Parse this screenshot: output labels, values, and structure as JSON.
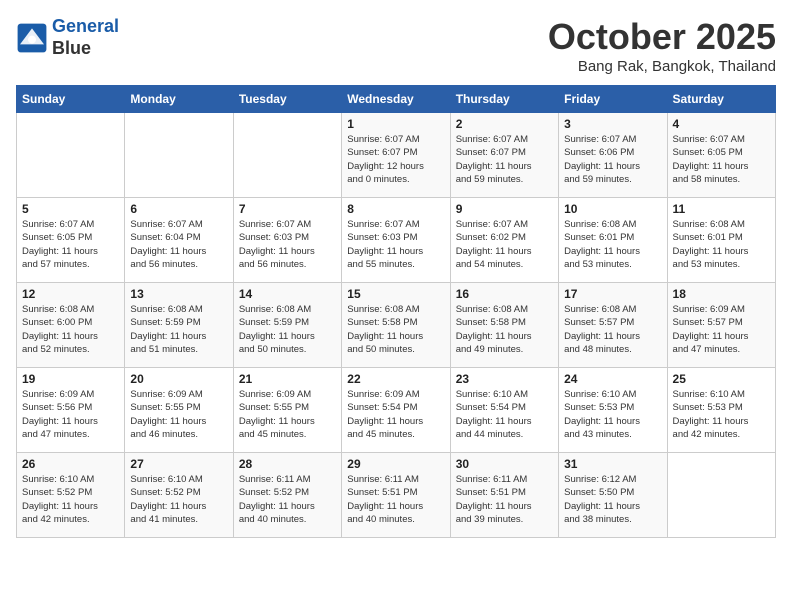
{
  "logo": {
    "line1": "General",
    "line2": "Blue"
  },
  "title": "October 2025",
  "location": "Bang Rak, Bangkok, Thailand",
  "days_of_week": [
    "Sunday",
    "Monday",
    "Tuesday",
    "Wednesday",
    "Thursday",
    "Friday",
    "Saturday"
  ],
  "weeks": [
    [
      {
        "day": "",
        "info": ""
      },
      {
        "day": "",
        "info": ""
      },
      {
        "day": "",
        "info": ""
      },
      {
        "day": "1",
        "info": "Sunrise: 6:07 AM\nSunset: 6:07 PM\nDaylight: 12 hours\nand 0 minutes."
      },
      {
        "day": "2",
        "info": "Sunrise: 6:07 AM\nSunset: 6:07 PM\nDaylight: 11 hours\nand 59 minutes."
      },
      {
        "day": "3",
        "info": "Sunrise: 6:07 AM\nSunset: 6:06 PM\nDaylight: 11 hours\nand 59 minutes."
      },
      {
        "day": "4",
        "info": "Sunrise: 6:07 AM\nSunset: 6:05 PM\nDaylight: 11 hours\nand 58 minutes."
      }
    ],
    [
      {
        "day": "5",
        "info": "Sunrise: 6:07 AM\nSunset: 6:05 PM\nDaylight: 11 hours\nand 57 minutes."
      },
      {
        "day": "6",
        "info": "Sunrise: 6:07 AM\nSunset: 6:04 PM\nDaylight: 11 hours\nand 56 minutes."
      },
      {
        "day": "7",
        "info": "Sunrise: 6:07 AM\nSunset: 6:03 PM\nDaylight: 11 hours\nand 56 minutes."
      },
      {
        "day": "8",
        "info": "Sunrise: 6:07 AM\nSunset: 6:03 PM\nDaylight: 11 hours\nand 55 minutes."
      },
      {
        "day": "9",
        "info": "Sunrise: 6:07 AM\nSunset: 6:02 PM\nDaylight: 11 hours\nand 54 minutes."
      },
      {
        "day": "10",
        "info": "Sunrise: 6:08 AM\nSunset: 6:01 PM\nDaylight: 11 hours\nand 53 minutes."
      },
      {
        "day": "11",
        "info": "Sunrise: 6:08 AM\nSunset: 6:01 PM\nDaylight: 11 hours\nand 53 minutes."
      }
    ],
    [
      {
        "day": "12",
        "info": "Sunrise: 6:08 AM\nSunset: 6:00 PM\nDaylight: 11 hours\nand 52 minutes."
      },
      {
        "day": "13",
        "info": "Sunrise: 6:08 AM\nSunset: 5:59 PM\nDaylight: 11 hours\nand 51 minutes."
      },
      {
        "day": "14",
        "info": "Sunrise: 6:08 AM\nSunset: 5:59 PM\nDaylight: 11 hours\nand 50 minutes."
      },
      {
        "day": "15",
        "info": "Sunrise: 6:08 AM\nSunset: 5:58 PM\nDaylight: 11 hours\nand 50 minutes."
      },
      {
        "day": "16",
        "info": "Sunrise: 6:08 AM\nSunset: 5:58 PM\nDaylight: 11 hours\nand 49 minutes."
      },
      {
        "day": "17",
        "info": "Sunrise: 6:08 AM\nSunset: 5:57 PM\nDaylight: 11 hours\nand 48 minutes."
      },
      {
        "day": "18",
        "info": "Sunrise: 6:09 AM\nSunset: 5:57 PM\nDaylight: 11 hours\nand 47 minutes."
      }
    ],
    [
      {
        "day": "19",
        "info": "Sunrise: 6:09 AM\nSunset: 5:56 PM\nDaylight: 11 hours\nand 47 minutes."
      },
      {
        "day": "20",
        "info": "Sunrise: 6:09 AM\nSunset: 5:55 PM\nDaylight: 11 hours\nand 46 minutes."
      },
      {
        "day": "21",
        "info": "Sunrise: 6:09 AM\nSunset: 5:55 PM\nDaylight: 11 hours\nand 45 minutes."
      },
      {
        "day": "22",
        "info": "Sunrise: 6:09 AM\nSunset: 5:54 PM\nDaylight: 11 hours\nand 45 minutes."
      },
      {
        "day": "23",
        "info": "Sunrise: 6:10 AM\nSunset: 5:54 PM\nDaylight: 11 hours\nand 44 minutes."
      },
      {
        "day": "24",
        "info": "Sunrise: 6:10 AM\nSunset: 5:53 PM\nDaylight: 11 hours\nand 43 minutes."
      },
      {
        "day": "25",
        "info": "Sunrise: 6:10 AM\nSunset: 5:53 PM\nDaylight: 11 hours\nand 42 minutes."
      }
    ],
    [
      {
        "day": "26",
        "info": "Sunrise: 6:10 AM\nSunset: 5:52 PM\nDaylight: 11 hours\nand 42 minutes."
      },
      {
        "day": "27",
        "info": "Sunrise: 6:10 AM\nSunset: 5:52 PM\nDaylight: 11 hours\nand 41 minutes."
      },
      {
        "day": "28",
        "info": "Sunrise: 6:11 AM\nSunset: 5:52 PM\nDaylight: 11 hours\nand 40 minutes."
      },
      {
        "day": "29",
        "info": "Sunrise: 6:11 AM\nSunset: 5:51 PM\nDaylight: 11 hours\nand 40 minutes."
      },
      {
        "day": "30",
        "info": "Sunrise: 6:11 AM\nSunset: 5:51 PM\nDaylight: 11 hours\nand 39 minutes."
      },
      {
        "day": "31",
        "info": "Sunrise: 6:12 AM\nSunset: 5:50 PM\nDaylight: 11 hours\nand 38 minutes."
      },
      {
        "day": "",
        "info": ""
      }
    ]
  ]
}
